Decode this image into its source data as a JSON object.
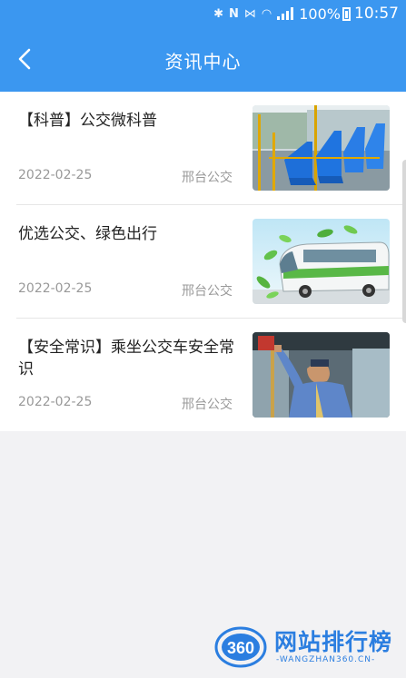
{
  "status_bar": {
    "battery": "100%",
    "time": "10:57",
    "icons": [
      "bluetooth-icon",
      "nfc-icon",
      "vibrate-icon",
      "wifi-icon",
      "signal-icon",
      "battery-icon"
    ]
  },
  "header": {
    "title": "资讯中心",
    "back_icon": "chevron-left-icon",
    "bg_color": "#3b97f0"
  },
  "news": [
    {
      "title": "【科普】公交微科普",
      "date": "2022-02-25",
      "source": "邢台公交",
      "image": "bus-interior-blue-seats"
    },
    {
      "title": "优选公交、绿色出行",
      "date": "2022-02-25",
      "source": "邢台公交",
      "image": "green-bus-with-leaves"
    },
    {
      "title": "【安全常识】乘坐公交车安全常识",
      "date": "2022-02-25",
      "source": "邢台公交",
      "image": "officer-on-bus"
    }
  ],
  "watermark": {
    "logo_text": "360",
    "name": "网站排行榜",
    "sub": "-WANGZHAN360.CN-"
  }
}
